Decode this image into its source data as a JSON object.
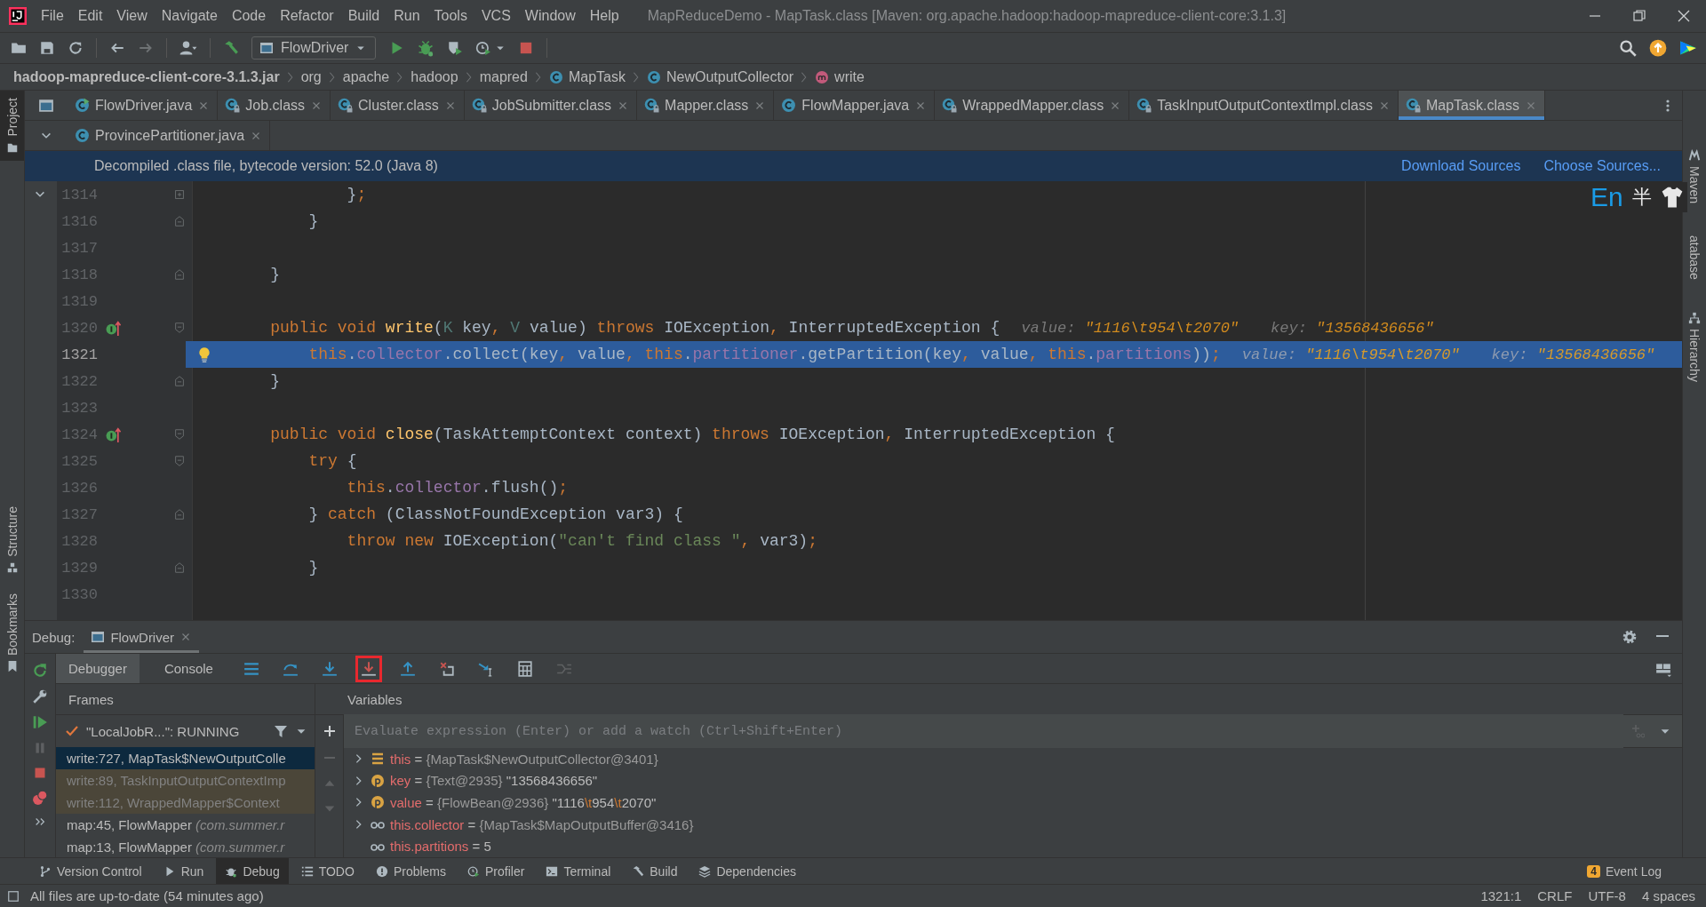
{
  "window": {
    "title": "MapReduceDemo - MapTask.class [Maven: org.apache.hadoop:hadoop-mapreduce-client-core:3.1.3]"
  },
  "menu": [
    "File",
    "Edit",
    "View",
    "Navigate",
    "Code",
    "Refactor",
    "Build",
    "Run",
    "Tools",
    "VCS",
    "Window",
    "Help"
  ],
  "toolbar": {
    "run_configuration": "FlowDriver"
  },
  "breadcrumbs": [
    {
      "label": "hadoop-mapreduce-client-core-3.1.3.jar",
      "kind": "jar"
    },
    {
      "label": "org",
      "kind": "package"
    },
    {
      "label": "apache",
      "kind": "package"
    },
    {
      "label": "hadoop",
      "kind": "package"
    },
    {
      "label": "mapred",
      "kind": "package"
    },
    {
      "label": "MapTask",
      "kind": "class"
    },
    {
      "label": "NewOutputCollector",
      "kind": "class"
    },
    {
      "label": "write",
      "kind": "method"
    }
  ],
  "tab_rows": [
    {
      "tabs": [
        {
          "label": "FlowDriver.java",
          "kind": "runnable-java",
          "selected": false
        },
        {
          "label": "Job.class",
          "kind": "class",
          "selected": false
        },
        {
          "label": "Cluster.class",
          "kind": "class",
          "selected": false
        },
        {
          "label": "JobSubmitter.class",
          "kind": "class",
          "selected": false
        },
        {
          "label": "Mapper.class",
          "kind": "class",
          "selected": false
        },
        {
          "label": "FlowMapper.java",
          "kind": "java",
          "selected": false
        },
        {
          "label": "WrappedMapper.class",
          "kind": "class",
          "selected": false
        },
        {
          "label": "TaskInputOutputContextImpl.class",
          "kind": "class",
          "selected": false
        },
        {
          "label": "MapTask.class",
          "kind": "class",
          "selected": true
        }
      ]
    },
    {
      "tabs": [
        {
          "label": "ProvincePartitioner.java",
          "kind": "java",
          "selected": false
        }
      ]
    }
  ],
  "banner": {
    "message": "Decompiled .class file, bytecode version: 52.0 (Java 8)",
    "links": [
      "Download Sources",
      "Choose Sources..."
    ]
  },
  "editor": {
    "lines": [
      {
        "number": "1314",
        "gutter": [
          {
            "kind": "fold-collapsed"
          }
        ],
        "current": false,
        "code": [
          {
            "text": "            }",
            "kind": "plain"
          },
          {
            "text": ";",
            "kind": "punct"
          }
        ]
      },
      {
        "number": "1316",
        "gutter": [
          {
            "kind": "fold-end"
          }
        ],
        "current": false,
        "code": [
          {
            "text": "        }",
            "kind": "plain"
          }
        ]
      },
      {
        "number": "1317",
        "current": false
      },
      {
        "number": "1318",
        "gutter": [
          {
            "kind": "fold-end"
          }
        ],
        "current": false,
        "code": [
          {
            "text": "    }",
            "kind": "plain"
          }
        ]
      },
      {
        "number": "1319",
        "current": false
      },
      {
        "number": "1320",
        "gutter": [
          {
            "kind": "implements"
          },
          {
            "kind": "fold-start"
          }
        ],
        "current": false,
        "code": [
          {
            "text": "    public void ",
            "kind": "keyword"
          },
          {
            "text": "write",
            "kind": "method"
          },
          {
            "text": "(",
            "kind": "plain"
          },
          {
            "text": "K",
            "kind": "type-param"
          },
          {
            "text": " key",
            "kind": "plain"
          },
          {
            "text": ", ",
            "kind": "punct"
          },
          {
            "text": "V",
            "kind": "type-param"
          },
          {
            "text": " value) ",
            "kind": "plain"
          },
          {
            "text": "throws",
            "kind": "keyword"
          },
          {
            "text": " IOException",
            "kind": "plain"
          },
          {
            "text": ", ",
            "kind": "punct"
          },
          {
            "text": "InterruptedException {",
            "kind": "plain"
          }
        ],
        "hints": [
          {
            "label": "value:",
            "value": "\"1116\\t954\\t2070\""
          },
          {
            "label": "key:",
            "value": "\"13568436656\""
          }
        ]
      },
      {
        "number": "1321",
        "gutter": [
          {
            "kind": "bulb"
          }
        ],
        "current": true,
        "code": [
          {
            "text": "        this",
            "kind": "keyword"
          },
          {
            "text": ".",
            "kind": "plain"
          },
          {
            "text": "collector",
            "kind": "field"
          },
          {
            "text": ".collect(key",
            "kind": "plain"
          },
          {
            "text": ", ",
            "kind": "punct"
          },
          {
            "text": "value",
            "kind": "plain"
          },
          {
            "text": ", ",
            "kind": "punct"
          },
          {
            "text": "this",
            "kind": "keyword"
          },
          {
            "text": ".",
            "kind": "plain"
          },
          {
            "text": "partitioner",
            "kind": "field"
          },
          {
            "text": ".getPartition(key",
            "kind": "plain"
          },
          {
            "text": ", ",
            "kind": "punct"
          },
          {
            "text": "value",
            "kind": "plain"
          },
          {
            "text": ", ",
            "kind": "punct"
          },
          {
            "text": "this",
            "kind": "keyword"
          },
          {
            "text": ".",
            "kind": "plain"
          },
          {
            "text": "partitions",
            "kind": "field"
          },
          {
            "text": "))",
            "kind": "plain"
          },
          {
            "text": ";",
            "kind": "punct"
          }
        ],
        "hints": [
          {
            "label": "value:",
            "value": "\"1116\\t954\\t2070\""
          },
          {
            "label": "key:",
            "value": "\"13568436656\""
          }
        ]
      },
      {
        "number": "1322",
        "gutter": [
          {
            "kind": "fold-end"
          }
        ],
        "current": false,
        "code": [
          {
            "text": "    }",
            "kind": "plain"
          }
        ]
      },
      {
        "number": "1323",
        "current": false
      },
      {
        "number": "1324",
        "gutter": [
          {
            "kind": "implements"
          },
          {
            "kind": "fold-start"
          }
        ],
        "current": false,
        "code": [
          {
            "text": "    public void ",
            "kind": "keyword"
          },
          {
            "text": "close",
            "kind": "method"
          },
          {
            "text": "(TaskAttemptContext context) ",
            "kind": "plain"
          },
          {
            "text": "throws",
            "kind": "keyword"
          },
          {
            "text": " IOException",
            "kind": "plain"
          },
          {
            "text": ", ",
            "kind": "punct"
          },
          {
            "text": "InterruptedException {",
            "kind": "plain"
          }
        ]
      },
      {
        "number": "1325",
        "gutter": [
          {
            "kind": "fold-start"
          }
        ],
        "current": false,
        "code": [
          {
            "text": "        try",
            "kind": "keyword"
          },
          {
            "text": " {",
            "kind": "plain"
          }
        ]
      },
      {
        "number": "1326",
        "current": false,
        "code": [
          {
            "text": "            this",
            "kind": "keyword"
          },
          {
            "text": ".",
            "kind": "plain"
          },
          {
            "text": "collector",
            "kind": "field"
          },
          {
            "text": ".flush()",
            "kind": "plain"
          },
          {
            "text": ";",
            "kind": "punct"
          }
        ]
      },
      {
        "number": "1327",
        "gutter": [
          {
            "kind": "fold-end"
          }
        ],
        "current": false,
        "code": [
          {
            "text": "        } ",
            "kind": "plain"
          },
          {
            "text": "catch",
            "kind": "keyword"
          },
          {
            "text": " (ClassNotFoundException var3) {",
            "kind": "plain"
          }
        ]
      },
      {
        "number": "1328",
        "current": false,
        "code": [
          {
            "text": "            throw new",
            "kind": "keyword"
          },
          {
            "text": " IOException(",
            "kind": "plain"
          },
          {
            "text": "\"can't find class \"",
            "kind": "string"
          },
          {
            "text": ", ",
            "kind": "punct"
          },
          {
            "text": "var3)",
            "kind": "plain"
          },
          {
            "text": ";",
            "kind": "punct"
          }
        ]
      },
      {
        "number": "1329",
        "gutter": [
          {
            "kind": "fold-end"
          }
        ],
        "current": false,
        "code": [
          {
            "text": "        }",
            "kind": "plain"
          }
        ]
      },
      {
        "number": "1330",
        "current": false
      }
    ]
  },
  "ime_bar": {
    "language": "En",
    "width_mode": "半"
  },
  "left_strip": {
    "top": [
      {
        "label": "Project",
        "selected": true
      }
    ],
    "bottom": [
      {
        "label": "Structure",
        "selected": false
      },
      {
        "label": "Bookmarks",
        "selected": false
      }
    ]
  },
  "right_strip": {
    "items": [
      {
        "label": "Maven",
        "kind": "maven"
      },
      {
        "label": "atabase",
        "kind": "database"
      },
      {
        "label": "Hierarchy",
        "kind": "hierarchy"
      }
    ]
  },
  "debug": {
    "label": "Debug:",
    "session": "FlowDriver",
    "tabs": [
      {
        "label": "Debugger",
        "selected": true
      },
      {
        "label": "Console",
        "selected": false
      }
    ],
    "actions": [
      {
        "kind": "threads",
        "highlighted": false
      },
      {
        "kind": "step-over",
        "highlighted": false
      },
      {
        "kind": "step-into",
        "highlighted": false
      },
      {
        "kind": "force-step-into",
        "highlighted": true
      },
      {
        "kind": "step-out",
        "highlighted": false
      },
      {
        "kind": "drop-frame",
        "highlighted": false
      },
      {
        "kind": "run-to-cursor",
        "highlighted": false
      },
      {
        "kind": "evaluate",
        "highlighted": false
      },
      {
        "kind": "trace",
        "highlighted": false
      }
    ],
    "frames": {
      "title": "Frames",
      "thread": "\"LocalJobR...\": RUNNING",
      "items": [
        {
          "method": "write:727, MapTask$NewOutputColle",
          "selected": true,
          "library": false
        },
        {
          "method": "write:89, TaskInputOutputContextImp",
          "selected": false,
          "library": true
        },
        {
          "method": "write:112, WrappedMapper$Context",
          "selected": false,
          "library": true
        },
        {
          "method": "map:45, FlowMapper",
          "location": "(com.summer.r",
          "selected": false,
          "library": false
        },
        {
          "method": "map:13, FlowMapper",
          "location": "(com.summer.r",
          "selected": false,
          "library": false
        }
      ]
    },
    "variables": {
      "title": "Variables",
      "placeholder": "Evaluate expression (Enter) or add a watch (Ctrl+Shift+Enter)",
      "items": [
        {
          "name": "this",
          "kind": "object",
          "operator": "=",
          "type": "{MapTask$NewOutputCollector@3401}",
          "expandable": true
        },
        {
          "name": "key",
          "kind": "param",
          "operator": "=",
          "type": "{Text@2935}",
          "value": [
            {
              "text": "\"13568436656\""
            }
          ],
          "expandable": true
        },
        {
          "name": "value",
          "kind": "param",
          "operator": "=",
          "type": "{FlowBean@2936}",
          "value": [
            {
              "text": "\"1116"
            },
            {
              "text": "\\t",
              "kind": "escape"
            },
            {
              "text": "954"
            },
            {
              "text": "\\t",
              "kind": "escape"
            },
            {
              "text": "2070\""
            }
          ],
          "expandable": true
        },
        {
          "name": "this.collector",
          "kind": "watch",
          "operator": "=",
          "type": "{MapTask$MapOutputBuffer@3416}",
          "expandable": true
        },
        {
          "name": "this.partitions",
          "kind": "watch",
          "operator": "=",
          "value": [
            {
              "text": "5"
            }
          ],
          "expandable": false
        }
      ]
    }
  },
  "tool_buttons": [
    {
      "label": "Version Control",
      "kind": "vcs",
      "selected": false
    },
    {
      "label": "Run",
      "kind": "run",
      "selected": false
    },
    {
      "label": "Debug",
      "kind": "debug",
      "selected": true
    },
    {
      "label": "TODO",
      "kind": "todo",
      "selected": false
    },
    {
      "label": "Problems",
      "kind": "problems",
      "selected": false
    },
    {
      "label": "Profiler",
      "kind": "profiler",
      "selected": false
    },
    {
      "label": "Terminal",
      "kind": "terminal",
      "selected": false
    },
    {
      "label": "Build",
      "kind": "build",
      "selected": false
    },
    {
      "label": "Dependencies",
      "kind": "dependencies",
      "selected": false
    }
  ],
  "event_log": {
    "label": "Event Log",
    "count": "4"
  },
  "status_bar": {
    "message": "All files are up-to-date (54 minutes ago)",
    "position": "1321:1",
    "line_separator": "CRLF",
    "encoding": "UTF-8",
    "indent": "4 spaces"
  }
}
